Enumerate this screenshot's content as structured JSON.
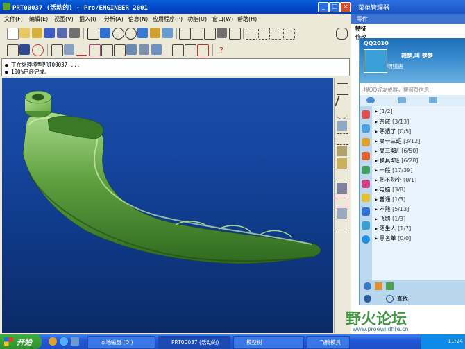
{
  "proe": {
    "title": "PRT00037 (活动的) - Pro/ENGINEER 2001",
    "menus": [
      "文件(F)",
      "编辑(E)",
      "视图(V)",
      "插入(I)",
      "分析(A)",
      "信息(N)",
      "应用程序(P)",
      "功能(U)",
      "窗口(W)",
      "帮助(H)"
    ],
    "messages": [
      "正在处理模型PRT00037 ...",
      "100%已经完成。"
    ],
    "window_buttons": [
      "_",
      "□",
      "×"
    ]
  },
  "model_tree": {
    "title": "菜单管理器",
    "subtitle": "零件",
    "items": [
      "特征",
      "修改"
    ]
  },
  "qq": {
    "title": "QQ2010",
    "nickname": "翘楚,叫 楚楚",
    "signature": "明镜遇",
    "search_placeholder": "搜QQ好友或群，搜网页信息",
    "groups": [
      {
        "name": "",
        "count": "[1/2]"
      },
      {
        "name": "亲戚",
        "count": "[3/13]"
      },
      {
        "name": "熟透了",
        "count": "[0/5]"
      },
      {
        "name": "高一三班",
        "count": "[3/12]"
      },
      {
        "name": "高三4班",
        "count": "[6/50]"
      },
      {
        "name": "模具4班",
        "count": "[6/28]"
      },
      {
        "name": "一般",
        "count": "[17/39]"
      },
      {
        "name": "熟不熟个",
        "count": "[0/1]"
      },
      {
        "name": "电脑",
        "count": "[3/8]"
      },
      {
        "name": "普通",
        "count": "[1/3]"
      },
      {
        "name": "不熟",
        "count": "[5/13]"
      },
      {
        "name": "飞鹅",
        "count": "[1/3]"
      },
      {
        "name": "陌生人",
        "count": "[1/7]"
      },
      {
        "name": "黑名单",
        "count": "[0/0]"
      }
    ],
    "bottom_search": "查找"
  },
  "watermark": {
    "text": "野火论坛",
    "url": "www.proewildfire.cn"
  },
  "taskbar": {
    "start": "开始",
    "tasks": [
      "本地磁盘 (D:)",
      "PRT00037 (活动的)",
      "模型树",
      "飞腾模具"
    ],
    "clock": "11:24"
  }
}
